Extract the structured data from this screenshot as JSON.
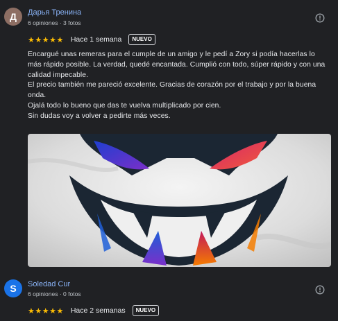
{
  "reviews": [
    {
      "avatar_letter": "Д",
      "author": "Дарья Тренина",
      "meta": "6 opiniones · 3 fotos",
      "stars": "★★★★★",
      "time": "Hace 1 semana",
      "badge": "NUEVO",
      "text": [
        "Encargué unas remeras para el cumple de un amigo y le pedí a Zory si podía hacerlas lo más rápido posible. La verdad, quedé encantada. Cumplió con todo, súper rápido y con una calidad impecable.",
        "El precio también me pareció excelente. Gracias de corazón por el trabajo y por la buena onda.",
        "Ojalá todo lo bueno que das te vuelva multiplicado por cien.",
        "Sin dudas voy a volver a pedirte más veces."
      ],
      "flag_icon": "report-flag-icon",
      "photo_icon": "review-photo"
    },
    {
      "avatar_letter": "S",
      "author": "Soledad Cur",
      "meta": "6 opiniones · 0 fotos",
      "stars": "★★★★★",
      "time": "Hace 2 semanas",
      "badge": "NUEVO",
      "flag_icon": "report-flag-icon"
    }
  ],
  "colors": {
    "background": "#202124",
    "author_link": "#8ab4f8",
    "star": "#fbbc04",
    "avatar_1": "#8d6e63",
    "avatar_2": "#1a73e8"
  }
}
